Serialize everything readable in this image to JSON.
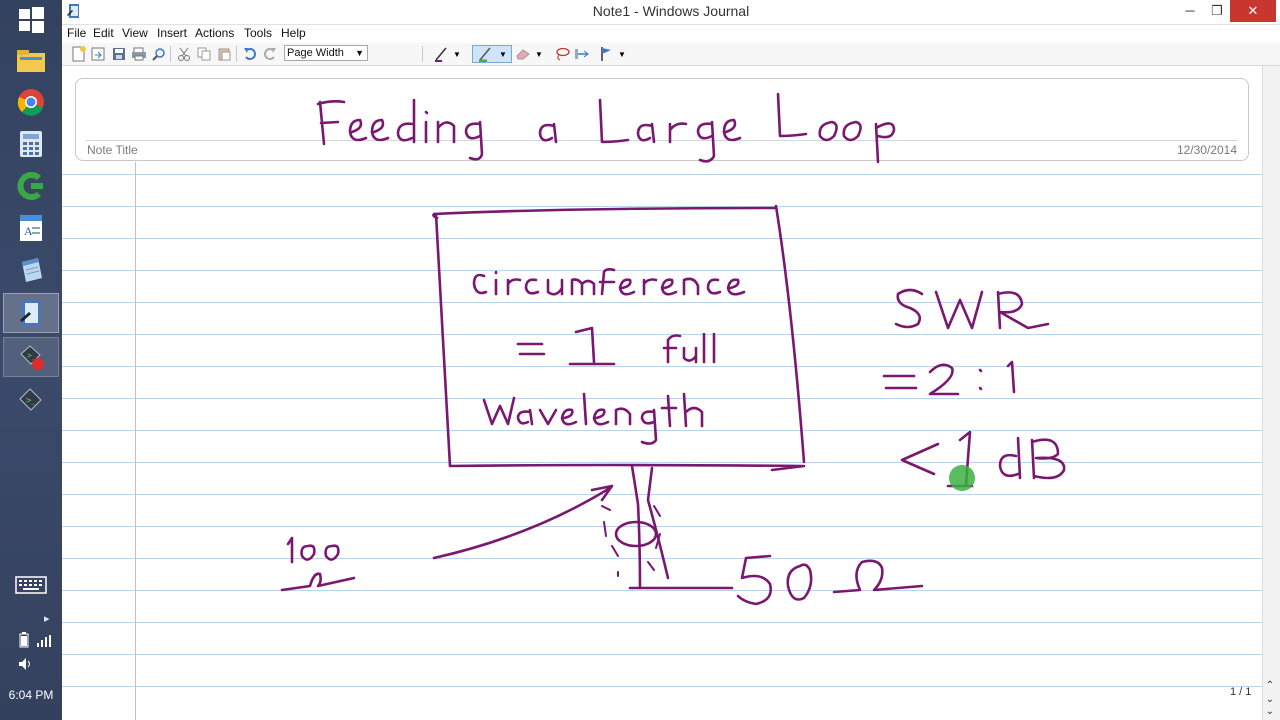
{
  "taskbar": {
    "clock": "6:04 PM",
    "items": [
      {
        "name": "start-icon"
      },
      {
        "name": "file-explorer-icon"
      },
      {
        "name": "chrome-icon"
      },
      {
        "name": "calculator-icon"
      },
      {
        "name": "camtasia-icon"
      },
      {
        "name": "wordpad-icon"
      },
      {
        "name": "notepad-icon"
      },
      {
        "name": "windows-journal-icon"
      },
      {
        "name": "recorder-icon"
      },
      {
        "name": "terminal-icon"
      }
    ]
  },
  "window": {
    "title": "Note1 - Windows Journal",
    "minimize": "─",
    "maximize": "❐",
    "close": "✕"
  },
  "menu": [
    "File",
    "Edit",
    "View",
    "Insert",
    "Actions",
    "Tools",
    "Help"
  ],
  "toolbar": {
    "zoom": "Page Width",
    "pen_color": "#7a1870",
    "highlighter_color": "#3cb043"
  },
  "note": {
    "title_label": "Note Title",
    "date": "12/30/2014",
    "page_indicator": "1 / 1",
    "handwritten_title": "Feeding a Large Loop",
    "handwriting": {
      "box_line1": "Circumference",
      "box_line2": "= 1 Full",
      "box_line3": "Wavelength",
      "swr": "SWR",
      "ratio": "= 2 : 1",
      "loss": "< 1 dB",
      "left_value": "100",
      "left_unit": "Ω",
      "impedance": "50 Ω"
    },
    "ink_color": "#7a1870",
    "pointer_color": "#3cb043"
  }
}
